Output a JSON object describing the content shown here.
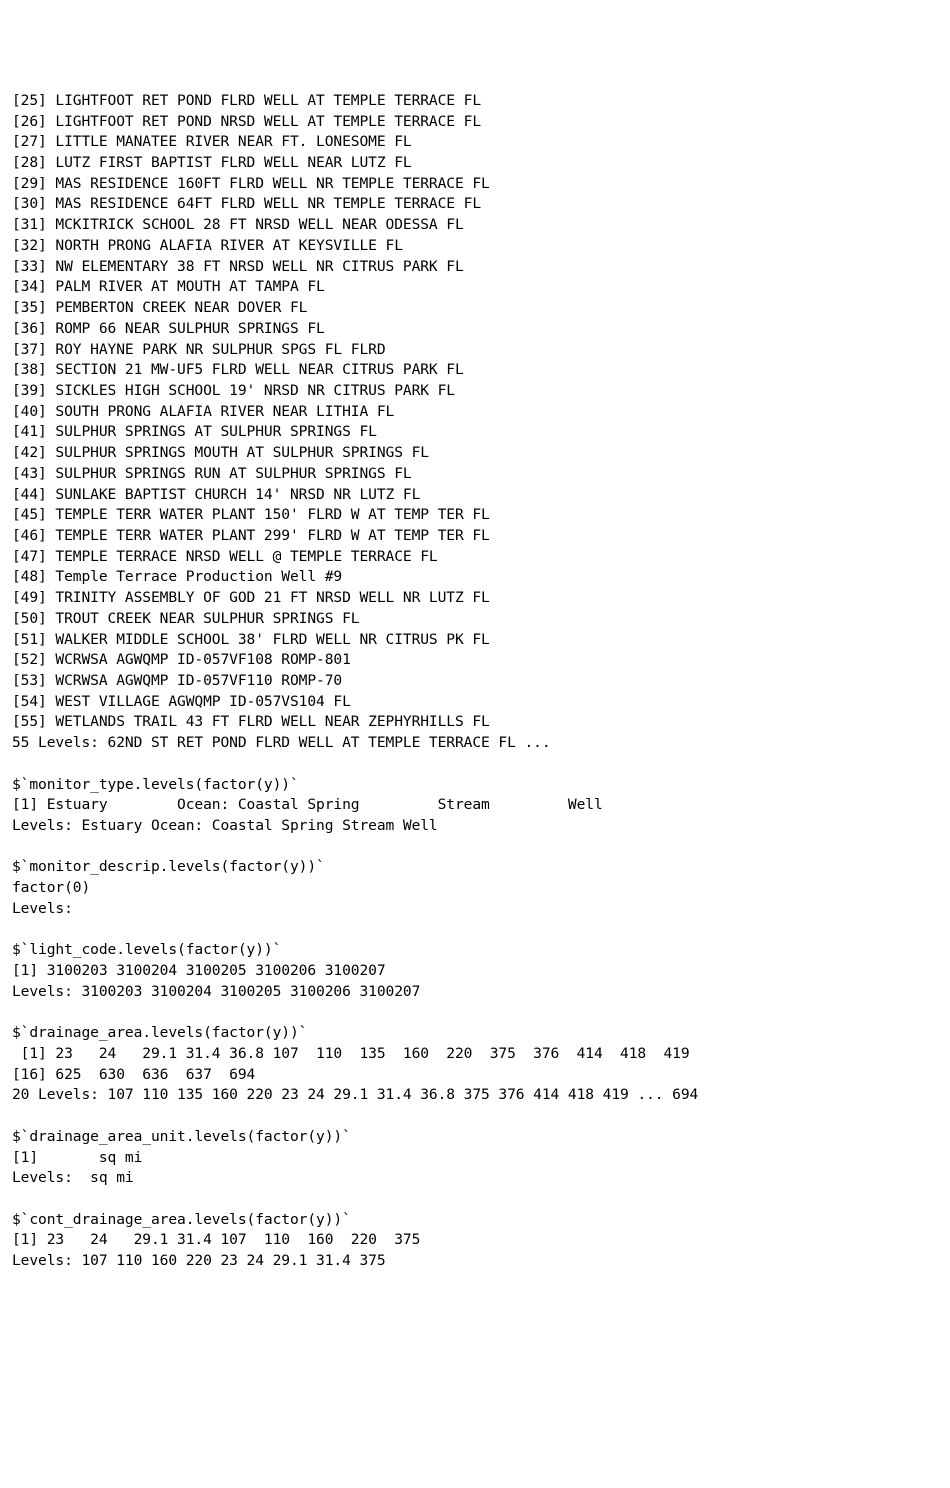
{
  "site_list": [
    {
      "idx": 25,
      "name": "LIGHTFOOT RET POND FLRD WELL AT TEMPLE TERRACE FL"
    },
    {
      "idx": 26,
      "name": "LIGHTFOOT RET POND NRSD WELL AT TEMPLE TERRACE FL"
    },
    {
      "idx": 27,
      "name": "LITTLE MANATEE RIVER NEAR FT. LONESOME FL"
    },
    {
      "idx": 28,
      "name": "LUTZ FIRST BAPTIST FLRD WELL NEAR LUTZ FL"
    },
    {
      "idx": 29,
      "name": "MAS RESIDENCE 160FT FLRD WELL NR TEMPLE TERRACE FL"
    },
    {
      "idx": 30,
      "name": "MAS RESIDENCE 64FT FLRD WELL NR TEMPLE TERRACE FL"
    },
    {
      "idx": 31,
      "name": "MCKITRICK SCHOOL 28 FT NRSD WELL NEAR ODESSA FL"
    },
    {
      "idx": 32,
      "name": "NORTH PRONG ALAFIA RIVER AT KEYSVILLE FL"
    },
    {
      "idx": 33,
      "name": "NW ELEMENTARY 38 FT NRSD WELL NR CITRUS PARK FL"
    },
    {
      "idx": 34,
      "name": "PALM RIVER AT MOUTH AT TAMPA FL"
    },
    {
      "idx": 35,
      "name": "PEMBERTON CREEK NEAR DOVER FL"
    },
    {
      "idx": 36,
      "name": "ROMP 66 NEAR SULPHUR SPRINGS FL"
    },
    {
      "idx": 37,
      "name": "ROY HAYNE PARK NR SULPHUR SPGS FL FLRD"
    },
    {
      "idx": 38,
      "name": "SECTION 21 MW-UF5 FLRD WELL NEAR CITRUS PARK FL"
    },
    {
      "idx": 39,
      "name": "SICKLES HIGH SCHOOL 19' NRSD NR CITRUS PARK FL"
    },
    {
      "idx": 40,
      "name": "SOUTH PRONG ALAFIA RIVER NEAR LITHIA FL"
    },
    {
      "idx": 41,
      "name": "SULPHUR SPRINGS AT SULPHUR SPRINGS FL"
    },
    {
      "idx": 42,
      "name": "SULPHUR SPRINGS MOUTH AT SULPHUR SPRINGS FL"
    },
    {
      "idx": 43,
      "name": "SULPHUR SPRINGS RUN AT SULPHUR SPRINGS FL"
    },
    {
      "idx": 44,
      "name": "SUNLAKE BAPTIST CHURCH 14' NRSD NR LUTZ FL"
    },
    {
      "idx": 45,
      "name": "TEMPLE TERR WATER PLANT 150' FLRD W AT TEMP TER FL"
    },
    {
      "idx": 46,
      "name": "TEMPLE TERR WATER PLANT 299' FLRD W AT TEMP TER FL"
    },
    {
      "idx": 47,
      "name": "TEMPLE TERRACE NRSD WELL @ TEMPLE TERRACE FL"
    },
    {
      "idx": 48,
      "name": "Temple Terrace Production Well #9"
    },
    {
      "idx": 49,
      "name": "TRINITY ASSEMBLY OF GOD 21 FT NRSD WELL NR LUTZ FL"
    },
    {
      "idx": 50,
      "name": "TROUT CREEK NEAR SULPHUR SPRINGS FL"
    },
    {
      "idx": 51,
      "name": "WALKER MIDDLE SCHOOL 38' FLRD WELL NR CITRUS PK FL"
    },
    {
      "idx": 52,
      "name": "WCRWSA AGWQMP ID-057VF108 ROMP-801"
    },
    {
      "idx": 53,
      "name": "WCRWSA AGWQMP ID-057VF110 ROMP-70"
    },
    {
      "idx": 54,
      "name": "WEST VILLAGE AGWQMP ID-057VS104 FL"
    },
    {
      "idx": 55,
      "name": "WETLANDS TRAIL 43 FT FLRD WELL NEAR ZEPHYRHILLS FL"
    }
  ],
  "site_list_levels_line": "55 Levels: 62ND ST RET POND FLRD WELL AT TEMPLE TERRACE FL ...",
  "sections": {
    "monitor_type": {
      "header": "$`monitor_type.levels(factor(y))`",
      "values_line": "[1] Estuary        Ocean: Coastal Spring         Stream         Well          ",
      "levels_line": "Levels: Estuary Ocean: Coastal Spring Stream Well"
    },
    "monitor_descrip": {
      "header": "$`monitor_descrip.levels(factor(y))`",
      "values_line": "factor(0)",
      "levels_line": "Levels: "
    },
    "light_code": {
      "header": "$`light_code.levels(factor(y))`",
      "values_line": "[1] 3100203 3100204 3100205 3100206 3100207",
      "levels_line": "Levels: 3100203 3100204 3100205 3100206 3100207"
    },
    "drainage_area": {
      "header": "$`drainage_area.levels(factor(y))`",
      "values_line_1": " [1] 23   24   29.1 31.4 36.8 107  110  135  160  220  375  376  414  418  419 ",
      "values_line_2": "[16] 625  630  636  637  694 ",
      "levels_line": "20 Levels: 107 110 135 160 220 23 24 29.1 31.4 36.8 375 376 414 418 419 ... 694"
    },
    "drainage_area_unit": {
      "header": "$`drainage_area_unit.levels(factor(y))`",
      "values_line": "[1]       sq mi",
      "levels_line": "Levels:  sq mi"
    },
    "cont_drainage_area": {
      "header": "$`cont_drainage_area.levels(factor(y))`",
      "values_line": "[1] 23   24   29.1 31.4 107  110  160  220  375 ",
      "levels_line": "Levels: 107 110 160 220 23 24 29.1 31.4 375"
    }
  }
}
